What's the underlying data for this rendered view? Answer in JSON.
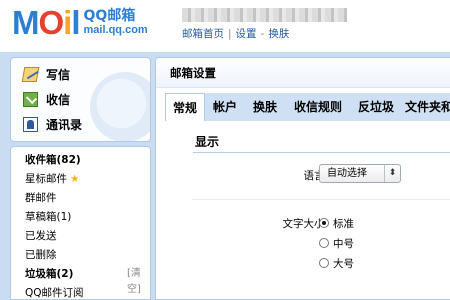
{
  "header": {
    "logo_letters": [
      "M",
      "O",
      "i",
      "l"
    ],
    "logo_cn": "QQ邮箱",
    "logo_url": "mail.qq.com",
    "links": [
      "邮箱首页",
      "设置",
      "换肤"
    ],
    "colors": {
      "blue": "#2b7fd6",
      "red": "#e8402f",
      "orange": "#f5a623"
    }
  },
  "actions": [
    {
      "label": "写信",
      "icon": "write-icon"
    },
    {
      "label": "收信",
      "icon": "inbox-icon"
    },
    {
      "label": "通讯录",
      "icon": "contacts-icon"
    }
  ],
  "folders": [
    {
      "label": "收件箱(82)",
      "bold": true
    },
    {
      "label": "星标邮件",
      "star": "★"
    },
    {
      "label": "群邮件"
    },
    {
      "label": "草稿箱(1)"
    },
    {
      "label": "已发送"
    },
    {
      "label": "已删除"
    },
    {
      "label": "垃圾箱(2)",
      "bold": true,
      "action": "[清空]"
    },
    {
      "label": "QQ邮件订阅"
    }
  ],
  "settings": {
    "title": "邮箱设置",
    "tabs": [
      "常规",
      "帐户",
      "换肤",
      "收信规则",
      "反垃圾",
      "文件夹和"
    ],
    "active_tab": "常规",
    "section": "显示",
    "language_label": "语言:",
    "language_value": "自动选择",
    "language_arrow": "⬍",
    "fontsize_label": "文字大小:",
    "fontsize_options": [
      {
        "label": "标准",
        "selected": true
      },
      {
        "label": "中号",
        "selected": false
      },
      {
        "label": "大号",
        "selected": false
      }
    ]
  }
}
